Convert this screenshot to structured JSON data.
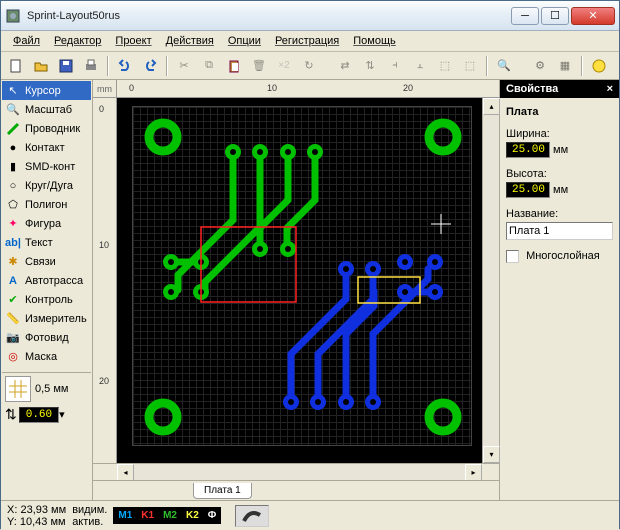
{
  "window": {
    "title": "Sprint-Layout50rus"
  },
  "menu": [
    "Файл",
    "Редактор",
    "Проект",
    "Действия",
    "Опции",
    "Регистрация",
    "Помощь"
  ],
  "tools": [
    {
      "id": "cursor",
      "label": "Курсор"
    },
    {
      "id": "zoom",
      "label": "Масштаб"
    },
    {
      "id": "wire",
      "label": "Проводник"
    },
    {
      "id": "pad",
      "label": "Контакт"
    },
    {
      "id": "smd",
      "label": "SMD-конт"
    },
    {
      "id": "arc",
      "label": "Круг/Дуга"
    },
    {
      "id": "poly",
      "label": "Полигон"
    },
    {
      "id": "shape",
      "label": "Фигура"
    },
    {
      "id": "text",
      "label": "Текст"
    },
    {
      "id": "conn",
      "label": "Связи"
    },
    {
      "id": "auto",
      "label": "Автотрасса"
    },
    {
      "id": "check",
      "label": "Контроль"
    },
    {
      "id": "meas",
      "label": "Измеритель"
    },
    {
      "id": "photo",
      "label": "Фотовид"
    },
    {
      "id": "mask",
      "label": "Маска"
    }
  ],
  "grid": {
    "label": "0,5 мм",
    "value": "0.60"
  },
  "ruler": {
    "unit": "mm",
    "h": [
      0,
      10,
      20
    ],
    "v": [
      0,
      10,
      20
    ]
  },
  "tabs": {
    "board": "Плата 1"
  },
  "props": {
    "header": "Свойства",
    "section": "Плата",
    "width_lbl": "Ширина:",
    "width_val": "25.00",
    "height_lbl": "Высота:",
    "height_val": "25.00",
    "name_lbl": "Название:",
    "name_val": "Плата 1",
    "multi_lbl": "Многослойная",
    "unit": "мм"
  },
  "status": {
    "x_lbl": "X:",
    "x": "23,93 мм",
    "y_lbl": "Y:",
    "y": "10,43 мм",
    "vis": "видим.",
    "act": "актив.",
    "layers": [
      {
        "t": "M1",
        "c": "#00aaff"
      },
      {
        "t": "K1",
        "c": "#ff3030"
      },
      {
        "t": "M2",
        "c": "#30c030"
      },
      {
        "t": "K2",
        "c": "#ffff40"
      },
      {
        "t": "Ф",
        "c": "#ffffff"
      }
    ]
  },
  "chart_data": {
    "type": "table",
    "title": "Board properties",
    "rows": [
      [
        "Ширина",
        "25.00",
        "мм"
      ],
      [
        "Высота",
        "25.00",
        "мм"
      ],
      [
        "Название",
        "Плата 1",
        ""
      ]
    ]
  }
}
